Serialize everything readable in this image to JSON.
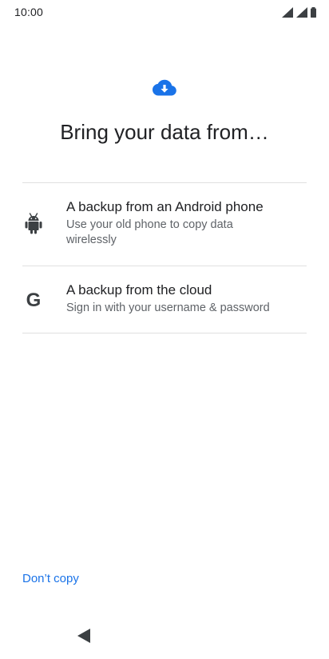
{
  "status_bar": {
    "time": "10:00",
    "icons": [
      "signal-icon",
      "signal-icon",
      "battery-icon"
    ]
  },
  "header": {
    "icon": "cloud-download-icon",
    "title": "Bring your data from…"
  },
  "options": [
    {
      "icon": "android-icon",
      "title": "A backup from an Android phone",
      "subtitle_line1": "Use your old phone to copy data",
      "subtitle_line2": "wirelessly"
    },
    {
      "icon": "google-icon",
      "icon_glyph": "G",
      "title": "A backup from the cloud",
      "subtitle_line1": "Sign in with your username & password"
    }
  ],
  "footer": {
    "dont_copy_label": "Don’t copy"
  },
  "nav": {
    "back_icon": "back-triangle-icon"
  },
  "colors": {
    "accent": "#1a73e8",
    "text_primary": "#202124",
    "text_secondary": "#5f6368",
    "divider": "#e0e0e0"
  }
}
